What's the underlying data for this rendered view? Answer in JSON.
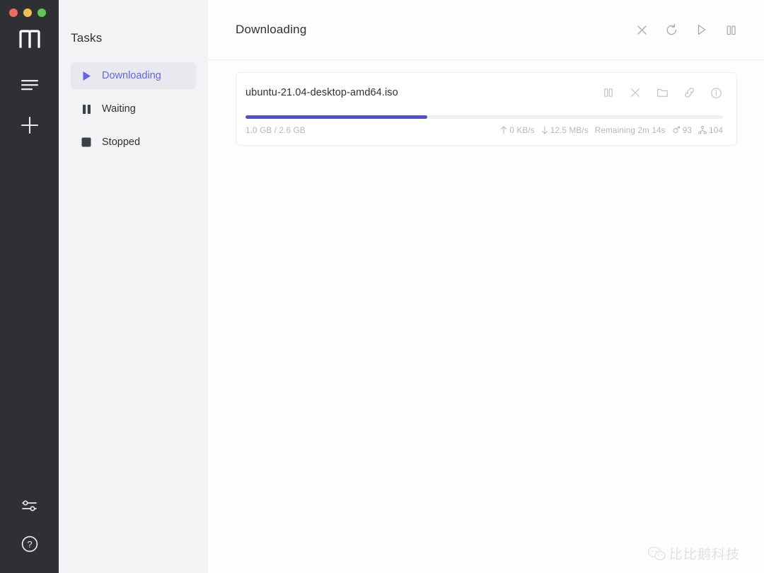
{
  "window": {
    "traffic_lights": [
      {
        "name": "close",
        "color": "#ec6a5f"
      },
      {
        "name": "minimize",
        "color": "#f4bd4f"
      },
      {
        "name": "maximize",
        "color": "#61c454"
      }
    ]
  },
  "rail": {
    "logo_label": "m",
    "buttons": [
      {
        "name": "task-list-icon",
        "label": "Tasks"
      },
      {
        "name": "add-task-icon",
        "label": "Add Task"
      },
      {
        "name": "preferences-icon",
        "label": "Preferences"
      },
      {
        "name": "help-icon",
        "label": "Help"
      }
    ]
  },
  "sidebar": {
    "title": "Tasks",
    "items": [
      {
        "label": "Downloading",
        "icon": "play-icon",
        "active": true
      },
      {
        "label": "Waiting",
        "icon": "pause-icon",
        "active": false
      },
      {
        "label": "Stopped",
        "icon": "stop-icon",
        "active": false
      }
    ]
  },
  "header": {
    "title": "Downloading",
    "actions": [
      {
        "name": "close-all-icon",
        "label": "Close"
      },
      {
        "name": "refresh-icon",
        "label": "Refresh"
      },
      {
        "name": "resume-all-icon",
        "label": "Resume All"
      },
      {
        "name": "pause-all-icon",
        "label": "Pause All"
      }
    ]
  },
  "task": {
    "file_name": "ubuntu-21.04-desktop-amd64.iso",
    "progress_percent": 38,
    "completed_size": "1.0 GB",
    "total_size": "2.6 GB",
    "size_label": "1.0 GB / 2.6 GB",
    "upload_speed": "0 KB/s",
    "download_speed": "12.5 MB/s",
    "remaining_label": "Remaining 2m 14s",
    "seeders": "93",
    "peers": "104",
    "actions": [
      {
        "name": "pause-icon",
        "label": "Pause"
      },
      {
        "name": "delete-icon",
        "label": "Delete"
      },
      {
        "name": "open-folder-icon",
        "label": "Open Folder"
      },
      {
        "name": "copy-link-icon",
        "label": "Copy Link"
      },
      {
        "name": "info-icon",
        "label": "Info"
      }
    ]
  },
  "watermark": {
    "text": "比比鹅科技"
  },
  "colors": {
    "accent": "#4f50d8",
    "accent_text": "#6166e8",
    "rail_bg": "#2e3033",
    "sidebar_bg": "#f2f3f5",
    "track": "#eef0f3",
    "meta_text": "#b4b7bd"
  }
}
